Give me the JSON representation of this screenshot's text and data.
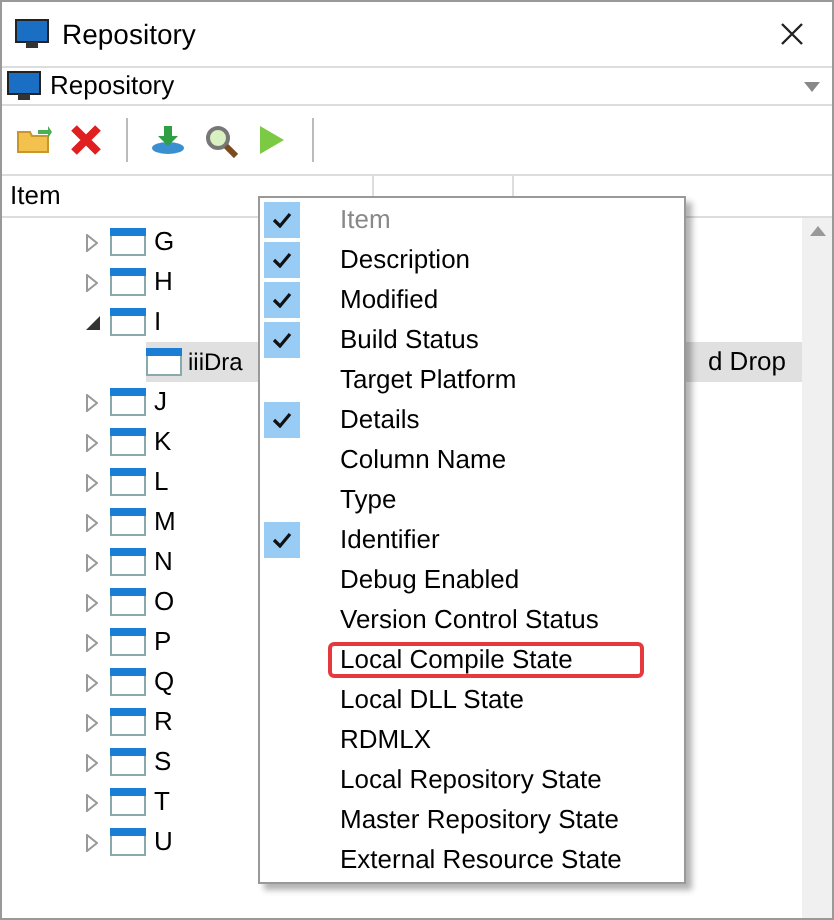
{
  "window": {
    "title": "Repository"
  },
  "selector": {
    "value": "Repository"
  },
  "table": {
    "columns": [
      "Item"
    ],
    "rows": [
      {
        "label": "G",
        "expanded": false,
        "children": []
      },
      {
        "label": "H",
        "expanded": false,
        "children": []
      },
      {
        "label": "I",
        "expanded": true,
        "children": [
          {
            "label": "iiiDra",
            "column_3": "d Drop",
            "selected": true
          }
        ]
      },
      {
        "label": "J",
        "expanded": false,
        "children": []
      },
      {
        "label": "K",
        "expanded": false,
        "children": []
      },
      {
        "label": "L",
        "expanded": false,
        "children": []
      },
      {
        "label": "M",
        "expanded": false,
        "children": []
      },
      {
        "label": "N",
        "expanded": false,
        "children": []
      },
      {
        "label": "O",
        "expanded": false,
        "children": []
      },
      {
        "label": "P",
        "expanded": false,
        "children": []
      },
      {
        "label": "Q",
        "expanded": false,
        "children": []
      },
      {
        "label": "R",
        "expanded": false,
        "children": []
      },
      {
        "label": "S",
        "expanded": false,
        "children": []
      },
      {
        "label": "T",
        "expanded": false,
        "children": []
      },
      {
        "label": "U",
        "expanded": false,
        "children": []
      }
    ]
  },
  "column_menu": [
    {
      "label": "Item",
      "checked": true,
      "disabled": true,
      "highlighted": false
    },
    {
      "label": "Description",
      "checked": true,
      "disabled": false,
      "highlighted": false
    },
    {
      "label": "Modified",
      "checked": true,
      "disabled": false,
      "highlighted": false
    },
    {
      "label": "Build Status",
      "checked": true,
      "disabled": false,
      "highlighted": false
    },
    {
      "label": "Target Platform",
      "checked": false,
      "disabled": false,
      "highlighted": false
    },
    {
      "label": "Details",
      "checked": true,
      "disabled": false,
      "highlighted": false
    },
    {
      "label": "Column Name",
      "checked": false,
      "disabled": false,
      "highlighted": false
    },
    {
      "label": "Type",
      "checked": false,
      "disabled": false,
      "highlighted": false
    },
    {
      "label": "Identifier",
      "checked": true,
      "disabled": false,
      "highlighted": false
    },
    {
      "label": "Debug Enabled",
      "checked": false,
      "disabled": false,
      "highlighted": false
    },
    {
      "label": "Version Control Status",
      "checked": false,
      "disabled": false,
      "highlighted": false
    },
    {
      "label": "Local Compile State",
      "checked": false,
      "disabled": false,
      "highlighted": true
    },
    {
      "label": "Local DLL State",
      "checked": false,
      "disabled": false,
      "highlighted": false
    },
    {
      "label": "RDMLX",
      "checked": false,
      "disabled": false,
      "highlighted": false
    },
    {
      "label": "Local Repository State",
      "checked": false,
      "disabled": false,
      "highlighted": false
    },
    {
      "label": "Master Repository State",
      "checked": false,
      "disabled": false,
      "highlighted": false
    },
    {
      "label": "External Resource State",
      "checked": false,
      "disabled": false,
      "highlighted": false
    }
  ]
}
